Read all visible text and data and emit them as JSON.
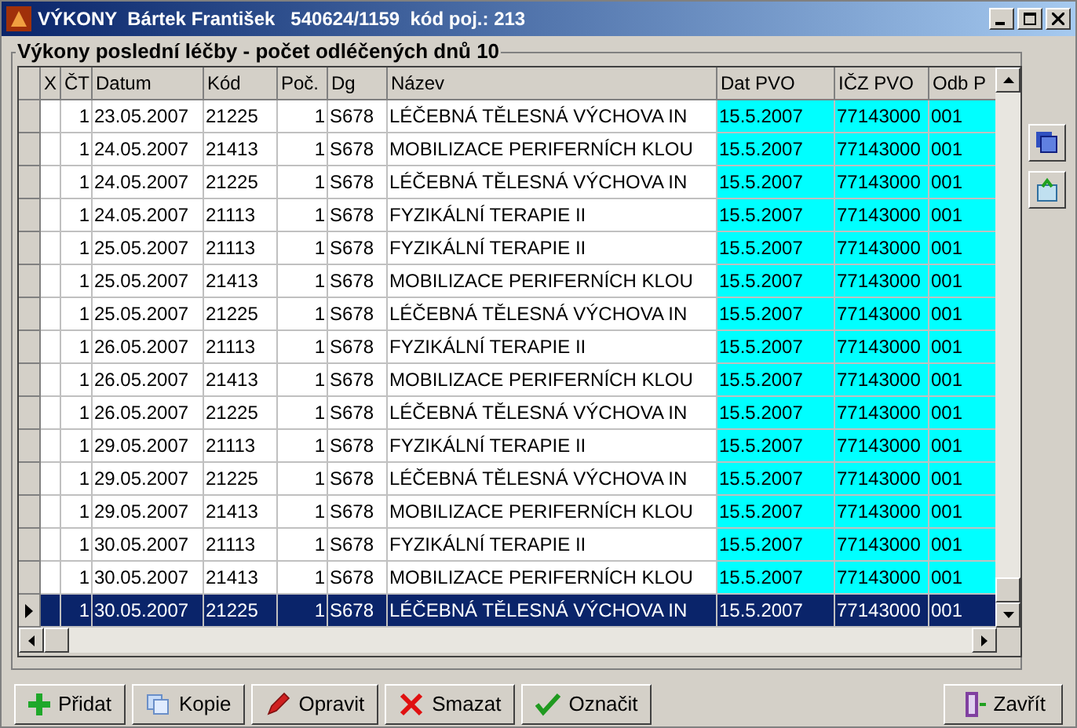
{
  "window": {
    "title": "VÝKONY  Bártek František   540624/1159  kód poj.: 213"
  },
  "group": {
    "title": "Výkony poslední léčby - počet odléčených dnů 10"
  },
  "table": {
    "columns": [
      {
        "label": "X",
        "kind": "text",
        "highlighted": false
      },
      {
        "label": "ČT",
        "kind": "number",
        "highlighted": false
      },
      {
        "label": "Datum",
        "kind": "text",
        "highlighted": false
      },
      {
        "label": "Kód",
        "kind": "text",
        "highlighted": false
      },
      {
        "label": "Poč.",
        "kind": "number",
        "highlighted": false
      },
      {
        "label": "Dg",
        "kind": "text",
        "highlighted": false
      },
      {
        "label": "Název",
        "kind": "text",
        "highlighted": false
      },
      {
        "label": "Dat PVO",
        "kind": "text",
        "highlighted": true
      },
      {
        "label": "IČZ PVO",
        "kind": "text",
        "highlighted": true
      },
      {
        "label": "Odb P",
        "kind": "text",
        "highlighted": true
      }
    ],
    "rows": [
      {
        "selected": false,
        "cells": [
          "",
          "1",
          "23.05.2007",
          "21225",
          "1",
          "S678",
          "LÉČEBNÁ TĚLESNÁ VÝCHOVA IN",
          "15.5.2007",
          "77143000",
          "001"
        ]
      },
      {
        "selected": false,
        "cells": [
          "",
          "1",
          "24.05.2007",
          "21413",
          "1",
          "S678",
          "MOBILIZACE PERIFERNÍCH KLOU",
          "15.5.2007",
          "77143000",
          "001"
        ]
      },
      {
        "selected": false,
        "cells": [
          "",
          "1",
          "24.05.2007",
          "21225",
          "1",
          "S678",
          "LÉČEBNÁ TĚLESNÁ VÝCHOVA IN",
          "15.5.2007",
          "77143000",
          "001"
        ]
      },
      {
        "selected": false,
        "cells": [
          "",
          "1",
          "24.05.2007",
          "21113",
          "1",
          "S678",
          "FYZIKÁLNÍ TERAPIE II",
          "15.5.2007",
          "77143000",
          "001"
        ]
      },
      {
        "selected": false,
        "cells": [
          "",
          "1",
          "25.05.2007",
          "21113",
          "1",
          "S678",
          "FYZIKÁLNÍ TERAPIE II",
          "15.5.2007",
          "77143000",
          "001"
        ]
      },
      {
        "selected": false,
        "cells": [
          "",
          "1",
          "25.05.2007",
          "21413",
          "1",
          "S678",
          "MOBILIZACE PERIFERNÍCH KLOU",
          "15.5.2007",
          "77143000",
          "001"
        ]
      },
      {
        "selected": false,
        "cells": [
          "",
          "1",
          "25.05.2007",
          "21225",
          "1",
          "S678",
          "LÉČEBNÁ TĚLESNÁ VÝCHOVA IN",
          "15.5.2007",
          "77143000",
          "001"
        ]
      },
      {
        "selected": false,
        "cells": [
          "",
          "1",
          "26.05.2007",
          "21113",
          "1",
          "S678",
          "FYZIKÁLNÍ TERAPIE II",
          "15.5.2007",
          "77143000",
          "001"
        ]
      },
      {
        "selected": false,
        "cells": [
          "",
          "1",
          "26.05.2007",
          "21413",
          "1",
          "S678",
          "MOBILIZACE PERIFERNÍCH KLOU",
          "15.5.2007",
          "77143000",
          "001"
        ]
      },
      {
        "selected": false,
        "cells": [
          "",
          "1",
          "26.05.2007",
          "21225",
          "1",
          "S678",
          "LÉČEBNÁ TĚLESNÁ VÝCHOVA IN",
          "15.5.2007",
          "77143000",
          "001"
        ]
      },
      {
        "selected": false,
        "cells": [
          "",
          "1",
          "29.05.2007",
          "21113",
          "1",
          "S678",
          "FYZIKÁLNÍ TERAPIE II",
          "15.5.2007",
          "77143000",
          "001"
        ]
      },
      {
        "selected": false,
        "cells": [
          "",
          "1",
          "29.05.2007",
          "21225",
          "1",
          "S678",
          "LÉČEBNÁ TĚLESNÁ VÝCHOVA IN",
          "15.5.2007",
          "77143000",
          "001"
        ]
      },
      {
        "selected": false,
        "cells": [
          "",
          "1",
          "29.05.2007",
          "21413",
          "1",
          "S678",
          "MOBILIZACE PERIFERNÍCH KLOU",
          "15.5.2007",
          "77143000",
          "001"
        ]
      },
      {
        "selected": false,
        "cells": [
          "",
          "1",
          "30.05.2007",
          "21113",
          "1",
          "S678",
          "FYZIKÁLNÍ TERAPIE II",
          "15.5.2007",
          "77143000",
          "001"
        ]
      },
      {
        "selected": false,
        "cells": [
          "",
          "1",
          "30.05.2007",
          "21413",
          "1",
          "S678",
          "MOBILIZACE PERIFERNÍCH KLOU",
          "15.5.2007",
          "77143000",
          "001"
        ]
      },
      {
        "selected": true,
        "cells": [
          "",
          "1",
          "30.05.2007",
          "21225",
          "1",
          "S678",
          "LÉČEBNÁ TĚLESNÁ VÝCHOVA IN",
          "15.5.2007",
          "77143000",
          "001"
        ]
      }
    ]
  },
  "buttons": [
    {
      "label": "Přidat",
      "kind": "add"
    },
    {
      "label": "Kopie",
      "kind": "copy"
    },
    {
      "label": "Opravit",
      "kind": "edit"
    },
    {
      "label": "Smazat",
      "kind": "delete"
    },
    {
      "label": "Označit",
      "kind": "mark"
    }
  ],
  "close_button": {
    "label": "Zavřít"
  }
}
